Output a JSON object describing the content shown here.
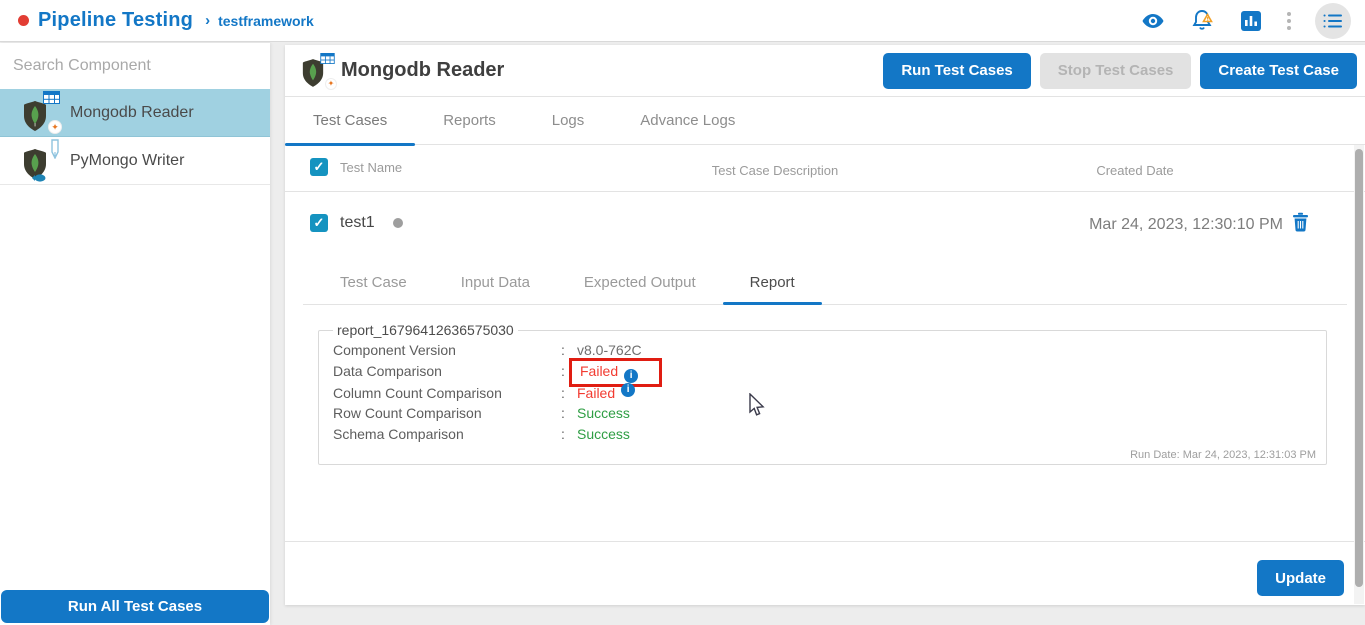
{
  "topbar": {
    "brand": "Pipeline Testing",
    "separator": "›",
    "breadcrumb": "testframework",
    "icons": [
      "eye-icon",
      "notification-bell-icon",
      "bar-chart-icon",
      "more-vertical-icon",
      "menu-list-icon"
    ]
  },
  "sidebar": {
    "search_placeholder": "Search Component",
    "items": [
      {
        "label": "Mongodb Reader",
        "selected": true
      },
      {
        "label": "PyMongo Writer",
        "selected": false
      }
    ],
    "run_all_label": "Run All Test Cases"
  },
  "main": {
    "title": "Mongodb Reader",
    "buttons": {
      "run": "Run Test Cases",
      "stop": "Stop Test Cases",
      "create": "Create Test Case"
    },
    "tabs": [
      {
        "label": "Test Cases",
        "active": true
      },
      {
        "label": "Reports",
        "active": false
      },
      {
        "label": "Logs",
        "active": false
      },
      {
        "label": "Advance Logs",
        "active": false
      }
    ],
    "table": {
      "headers": {
        "name": "Test Name",
        "description": "Test Case Description",
        "created": "Created Date"
      }
    },
    "row": {
      "name": "test1",
      "created": "Mar 24, 2023, 12:30:10 PM"
    },
    "subtabs": [
      {
        "label": "Test Case",
        "active": false
      },
      {
        "label": "Input Data",
        "active": false
      },
      {
        "label": "Expected Output",
        "active": false
      },
      {
        "label": "Report",
        "active": true
      }
    ],
    "report": {
      "legend": "report_16796412636575030",
      "rows": [
        {
          "label": "Component Version",
          "colon": ":",
          "value": "v8.0-762C",
          "status": "plain",
          "info": false,
          "highlighted": false
        },
        {
          "label": "Data Comparison",
          "colon": ":",
          "value": "Failed",
          "status": "failed",
          "info": true,
          "highlighted": true
        },
        {
          "label": "Column Count Comparison",
          "colon": ":",
          "value": "Failed",
          "status": "failed",
          "info": true,
          "highlighted": false
        },
        {
          "label": "Row Count Comparison",
          "colon": ":",
          "value": "Success",
          "status": "success",
          "info": false,
          "highlighted": false
        },
        {
          "label": "Schema Comparison",
          "colon": ":",
          "value": "Success",
          "status": "success",
          "info": false,
          "highlighted": false
        }
      ],
      "info_glyph": "i",
      "run_date": "Run Date: Mar 24, 2023, 12:31:03 PM"
    },
    "update_label": "Update",
    "checkbox_glyph": "✓"
  },
  "colors": {
    "accent_blue": "#1377c6",
    "checkbox_blue": "#1593c0",
    "selected_item_bg": "#a0d1e1",
    "failed_red": "#f23b31",
    "success_green": "#2f9e44",
    "highlight_box_red": "#e01d12",
    "brand_dot_red": "#e23d33",
    "warning_orange": "#f0a028",
    "mongo_leaf_green": "#58a14e"
  }
}
